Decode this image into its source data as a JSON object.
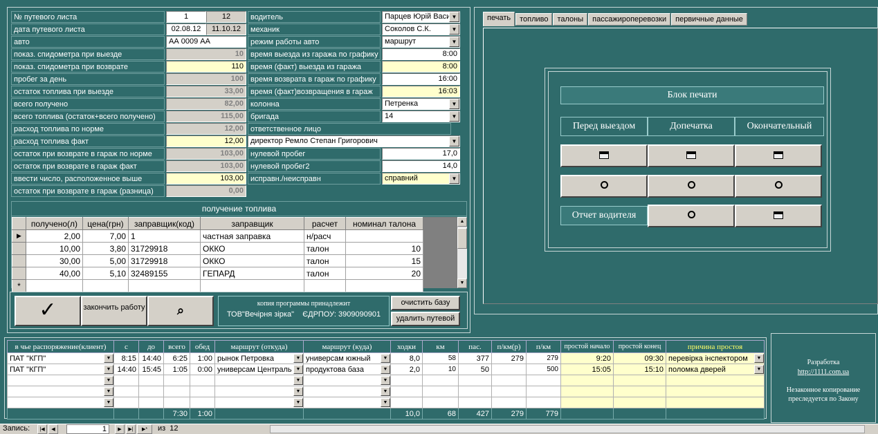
{
  "form": {
    "labels_left": [
      "№ путевого листа",
      "дата путевого листа",
      "авто",
      "показ. спидометра при выезде",
      "показ. спидометра при возврате",
      "пробег за день",
      "остаток топлива при выезде",
      "всего получено",
      "всего топлива (остаток+всего получено)",
      "расход топлива по норме",
      "расход топлива факт",
      "остаток при возврате в гараж по норме",
      "остаток при возврате в гараж  факт",
      "ввести число, расположенное выше",
      "остаток при возврате в гараж (разница)"
    ],
    "waybill_no": "1",
    "waybill_no2": "12",
    "date": "02.08.12",
    "date2": "11.10.12",
    "car": "АА 0009 АА",
    "odo_out": "10",
    "odo_in": "110",
    "mileage": "100",
    "fuel_out": "33,00",
    "fuel_received": "82,00",
    "fuel_total": "115,00",
    "fuel_norm": "12,00",
    "fuel_fact": "12,00",
    "rem_norm": "103,00",
    "rem_fact": "103,00",
    "enter_above": "103,00",
    "rem_diff": "0,00",
    "labels_right": [
      "водитель",
      "механик",
      "режим работы авто",
      "время выезда из гаража по графику",
      "время (факт) выезда из гаража",
      "время возврата в гараж по графику",
      "время (факт)возвращения в гараж",
      "колонна",
      "бригада",
      "ответственное лицо"
    ],
    "driver": "Парцев Юрій Васи.",
    "mechanic": "Соколов С.К.",
    "mode": "маршрут",
    "t_out_plan": "8:00",
    "t_out_fact": "8:00",
    "t_in_plan": "16:00",
    "t_in_fact": "16:03",
    "column": "Петренка",
    "brigade": "14",
    "responsible": "директор Ремло Степан Григорович",
    "labels_right2": [
      "нулевой пробег",
      "нулевой пробег2",
      "исправн./неисправн"
    ],
    "zero_run": "17,0",
    "zero_run2": "14,0",
    "status": "справний"
  },
  "fuel_grid": {
    "title": "получение топлива",
    "columns": [
      "получено(л)",
      "цена(грн)",
      "заправщик(код)",
      "заправщик",
      "расчет",
      "номинал талона"
    ],
    "rows": [
      [
        "2,00",
        "7,00",
        "1",
        "частная заправка",
        "н/расч",
        ""
      ],
      [
        "10,00",
        "3,80",
        "31729918",
        "ОККО",
        "талон",
        "10"
      ],
      [
        "30,00",
        "5,00",
        "31729918",
        "ОККО",
        "талон",
        "15"
      ],
      [
        "40,00",
        "5,10",
        "32489155",
        "ГЕПАРД",
        "талон",
        "20"
      ]
    ],
    "new_row_marker": "*"
  },
  "actions": {
    "check": "✓",
    "finish": "закончить работу",
    "binoculars": "⌕",
    "owner_line1": "копия программы принадлежит",
    "owner_line2": "ТОВ\"Вечірня зірка\"    ЄДРПОУ: 3909090901",
    "clear_db": "очистить базу",
    "delete_waybill": "удалить путевой"
  },
  "tabs": [
    "печать",
    "топливо",
    "талоны",
    "пассажироперевозки",
    "первичные данные"
  ],
  "print_block": {
    "title": "Блок печати",
    "col_labels": [
      "Перед выездом",
      "Допечатка",
      "Окончательный"
    ],
    "driver_report": "Отчет водителя"
  },
  "routes": {
    "columns": [
      "в чье распоряжение(клиент)",
      "с",
      "до",
      "всего",
      "обед",
      "маршрут (откуда)",
      "маршрут (куда)",
      "ходки",
      "км",
      "пас.",
      "п/км(р)",
      "п/км",
      "простой начало",
      "простой конец",
      "причина простоя"
    ],
    "rows": [
      [
        "ПАТ \"КГП\"",
        "8:15",
        "14:40",
        "6:25",
        "1:00",
        "рынок Петровка",
        "универсам южный",
        "8,0",
        "58",
        "377",
        "279",
        "279",
        "9:20",
        "09:30",
        "перевірка інспектором"
      ],
      [
        "ПАТ \"КГП\"",
        "14:40",
        "15:45",
        "1:05",
        "0:00",
        "универсам Централь",
        "продуктова база",
        "2,0",
        "10",
        "50",
        "",
        "500",
        "15:05",
        "15:10",
        "поломка дверей"
      ]
    ],
    "totals": {
      "total": "7:30",
      "lunch": "1:00",
      "trips": "10,0",
      "km": "68",
      "pas": "427",
      "pkmr": "279",
      "pkm": "779"
    }
  },
  "dev": {
    "line1": "Разработка",
    "link": "http://1111.com.ua",
    "line2": "Незаконное копирование преследуется по Закону"
  },
  "nav": {
    "label": "Запись:",
    "current": "1",
    "of": "из  12"
  }
}
